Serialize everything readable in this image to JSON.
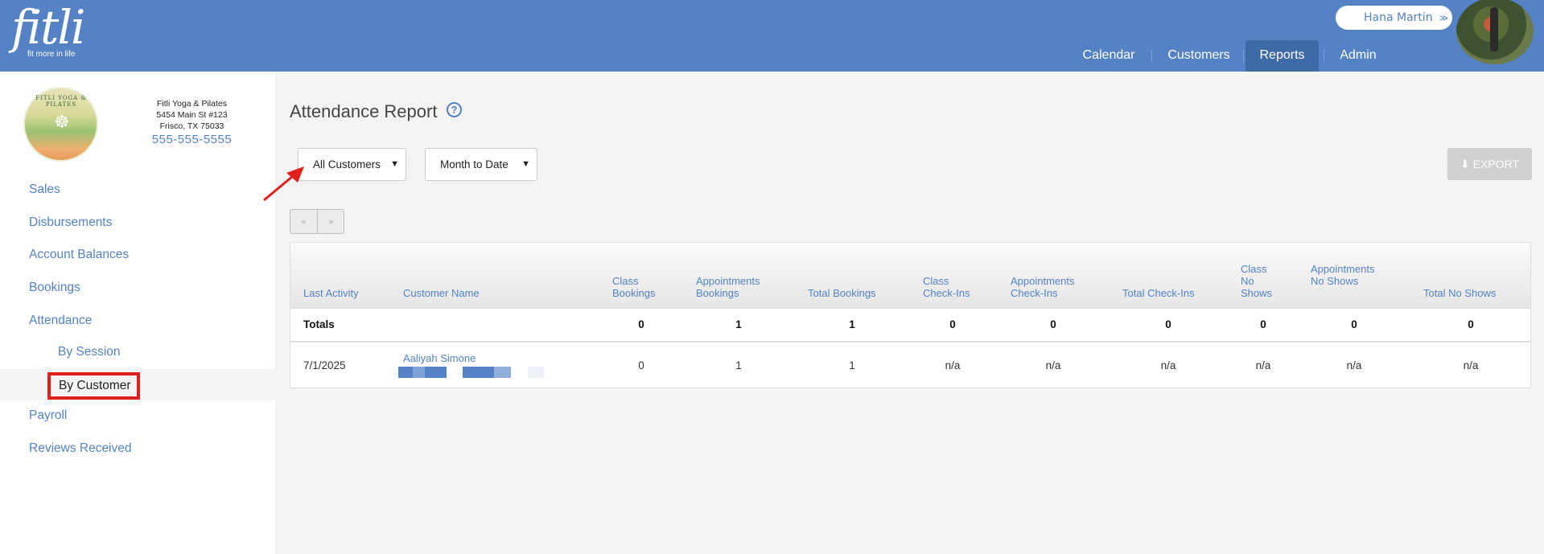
{
  "brand": {
    "logo_text": "fitli",
    "tagline": "fit more in life"
  },
  "user": {
    "name": "Hana Martin",
    "chevron_icon": "double-chevron-down-icon"
  },
  "nav": {
    "items": [
      "Calendar",
      "Customers",
      "Reports",
      "Admin"
    ],
    "active": "Reports"
  },
  "studio": {
    "logo_text": "FITLI YOGA & PILATES",
    "name": "Fitli Yoga & Pilates",
    "address1": "5454 Main St #123",
    "address2": "Frisco, TX 75033",
    "phone": "555-555-5555"
  },
  "sidebar": {
    "items": [
      "Sales",
      "Disbursements",
      "Account Balances",
      "Bookings",
      "Attendance"
    ],
    "sub_items": [
      "By Session",
      "By Customer"
    ],
    "items_after": [
      "Payroll",
      "Reviews Received"
    ],
    "active": "By Customer"
  },
  "page": {
    "title": "Attendance Report",
    "help_icon": "question-circle-icon"
  },
  "filters": {
    "customers": "All Customers",
    "period": "Month to Date"
  },
  "export": {
    "label": "EXPORT",
    "icon": "download-icon"
  },
  "pager": {
    "prev": "«",
    "next": "»"
  },
  "table": {
    "headers": [
      "Last Activity",
      "Customer Name",
      "Class Bookings",
      "Appointments Bookings",
      "Total Bookings",
      "Class Check-Ins",
      "Appointments Check-Ins",
      "Total Check-Ins",
      "Class No Shows",
      "Appointments No Shows",
      "Total No Shows"
    ],
    "totals": {
      "label": "Totals",
      "values": [
        "0",
        "1",
        "1",
        "0",
        "0",
        "0",
        "0",
        "0",
        "0"
      ]
    },
    "rows": [
      {
        "last_activity": "7/1/2025",
        "customer_name": "Aaliyah Simone",
        "values": [
          "0",
          "1",
          "1",
          "n/a",
          "n/a",
          "n/a",
          "n/a",
          "n/a",
          "n/a"
        ]
      }
    ]
  },
  "colors": {
    "header": "#5482c4",
    "highlight_box": "#e0201a",
    "arrow": "#e0201a"
  }
}
